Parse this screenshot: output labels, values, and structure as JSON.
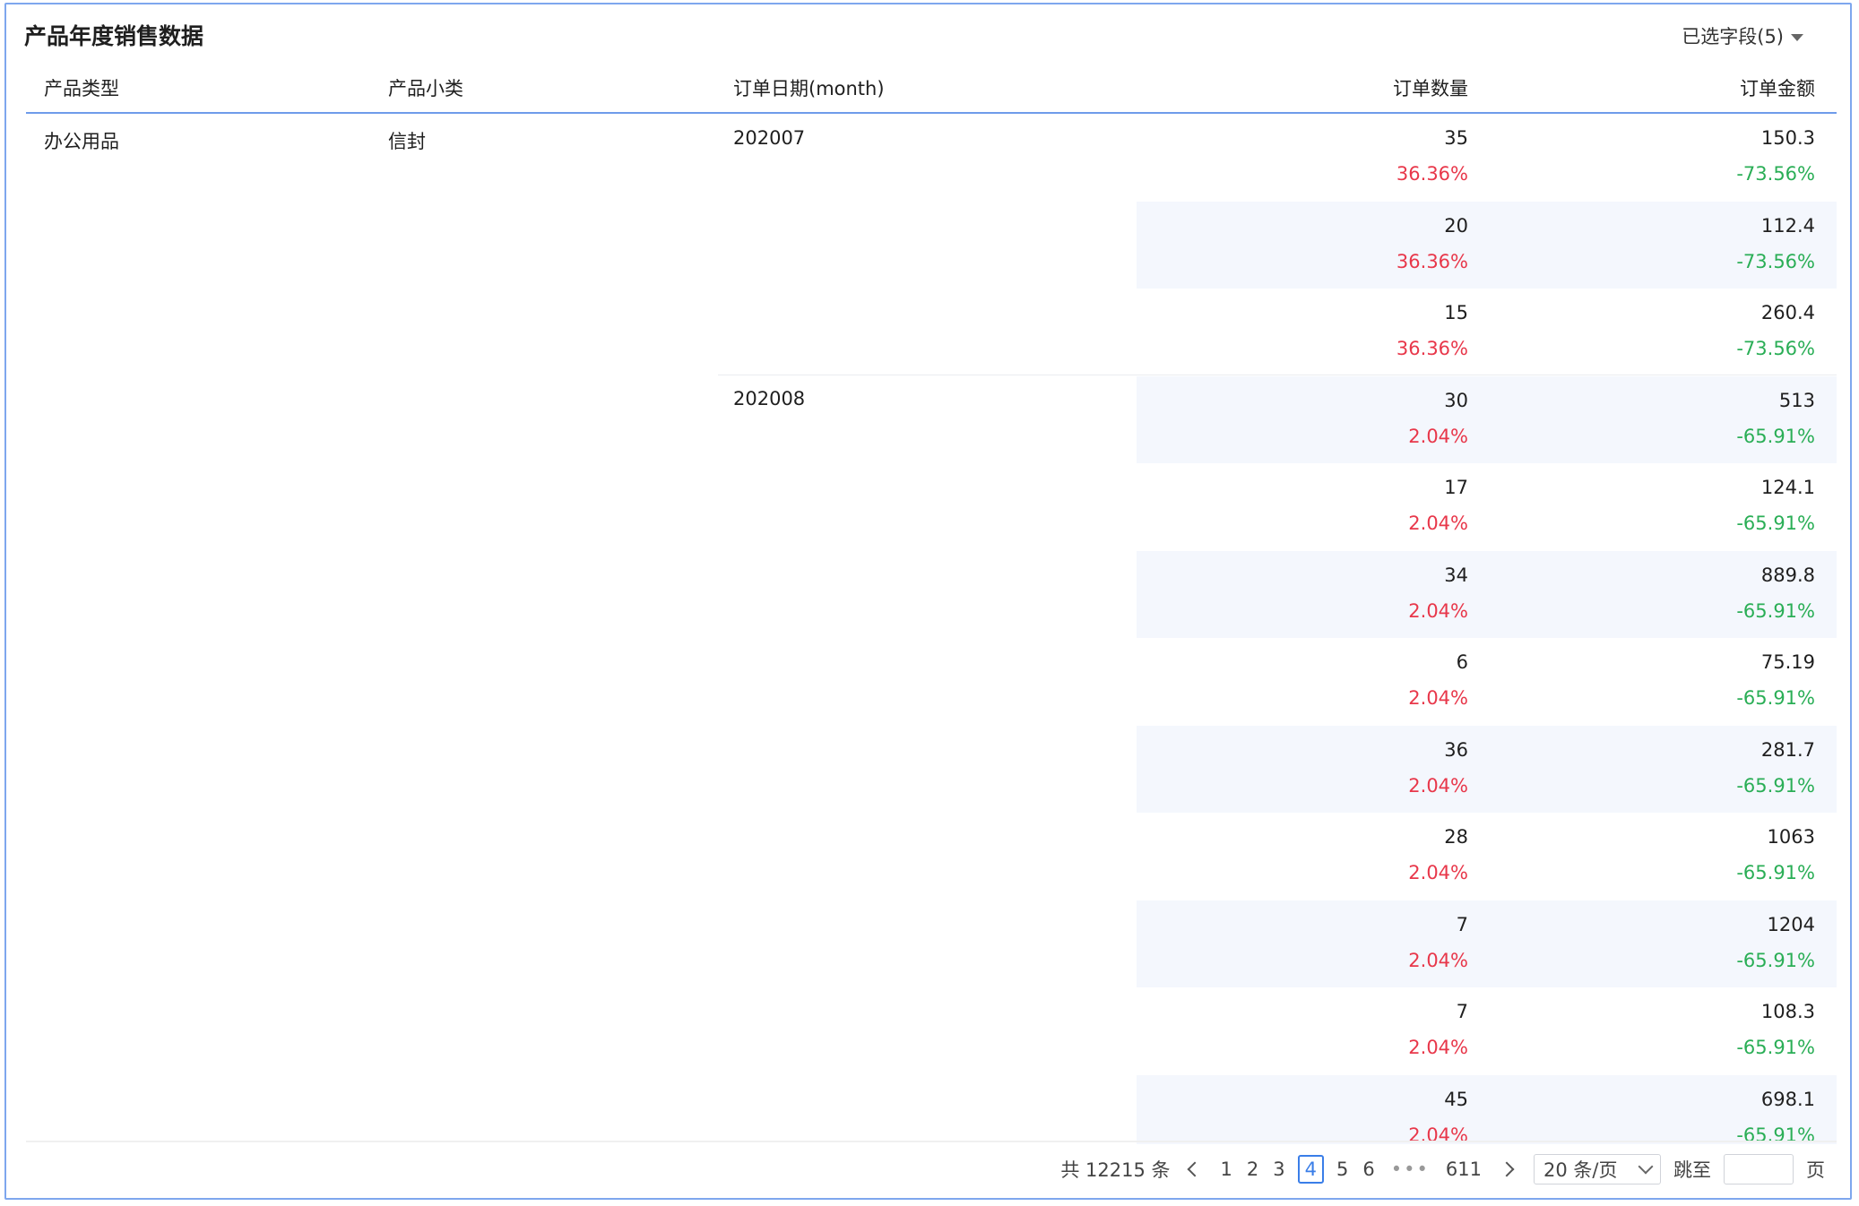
{
  "title": "产品年度销售数据",
  "fields_selector": {
    "label": "已选字段(5)"
  },
  "columns": [
    "产品类型",
    "产品小类",
    "订单日期(month)",
    "订单数量",
    "订单金额"
  ],
  "group": {
    "product_type": "办公用品",
    "product_subtype": "信封",
    "months": [
      "202007",
      "202008"
    ]
  },
  "rows": [
    {
      "qty": "35",
      "qty_pct": "36.36%",
      "amount": "150.3",
      "amount_pct": "-73.56%"
    },
    {
      "qty": "20",
      "qty_pct": "36.36%",
      "amount": "112.4",
      "amount_pct": "-73.56%"
    },
    {
      "qty": "15",
      "qty_pct": "36.36%",
      "amount": "260.4",
      "amount_pct": "-73.56%"
    },
    {
      "qty": "30",
      "qty_pct": "2.04%",
      "amount": "513",
      "amount_pct": "-65.91%"
    },
    {
      "qty": "17",
      "qty_pct": "2.04%",
      "amount": "124.1",
      "amount_pct": "-65.91%"
    },
    {
      "qty": "34",
      "qty_pct": "2.04%",
      "amount": "889.8",
      "amount_pct": "-65.91%"
    },
    {
      "qty": "6",
      "qty_pct": "2.04%",
      "amount": "75.19",
      "amount_pct": "-65.91%"
    },
    {
      "qty": "36",
      "qty_pct": "2.04%",
      "amount": "281.7",
      "amount_pct": "-65.91%"
    },
    {
      "qty": "28",
      "qty_pct": "2.04%",
      "amount": "1063",
      "amount_pct": "-65.91%"
    },
    {
      "qty": "7",
      "qty_pct": "2.04%",
      "amount": "1204",
      "amount_pct": "-65.91%"
    },
    {
      "qty": "7",
      "qty_pct": "2.04%",
      "amount": "108.3",
      "amount_pct": "-65.91%"
    },
    {
      "qty": "45",
      "qty_pct": "2.04%",
      "amount": "698.1",
      "amount_pct": "-65.91%"
    }
  ],
  "pagination": {
    "total_label": "共 12215 条",
    "pages": [
      "1",
      "2",
      "3",
      "4",
      "5",
      "6"
    ],
    "current_page": "4",
    "ellipsis": "•••",
    "last_page": "611",
    "page_size": "20 条/页",
    "jump_label": "跳至",
    "page_suffix": "页"
  },
  "colors": {
    "increase": "#e8374a",
    "decrease": "#2aae56",
    "accent": "#3a7ee8",
    "stripe": "#f4f7fd"
  }
}
